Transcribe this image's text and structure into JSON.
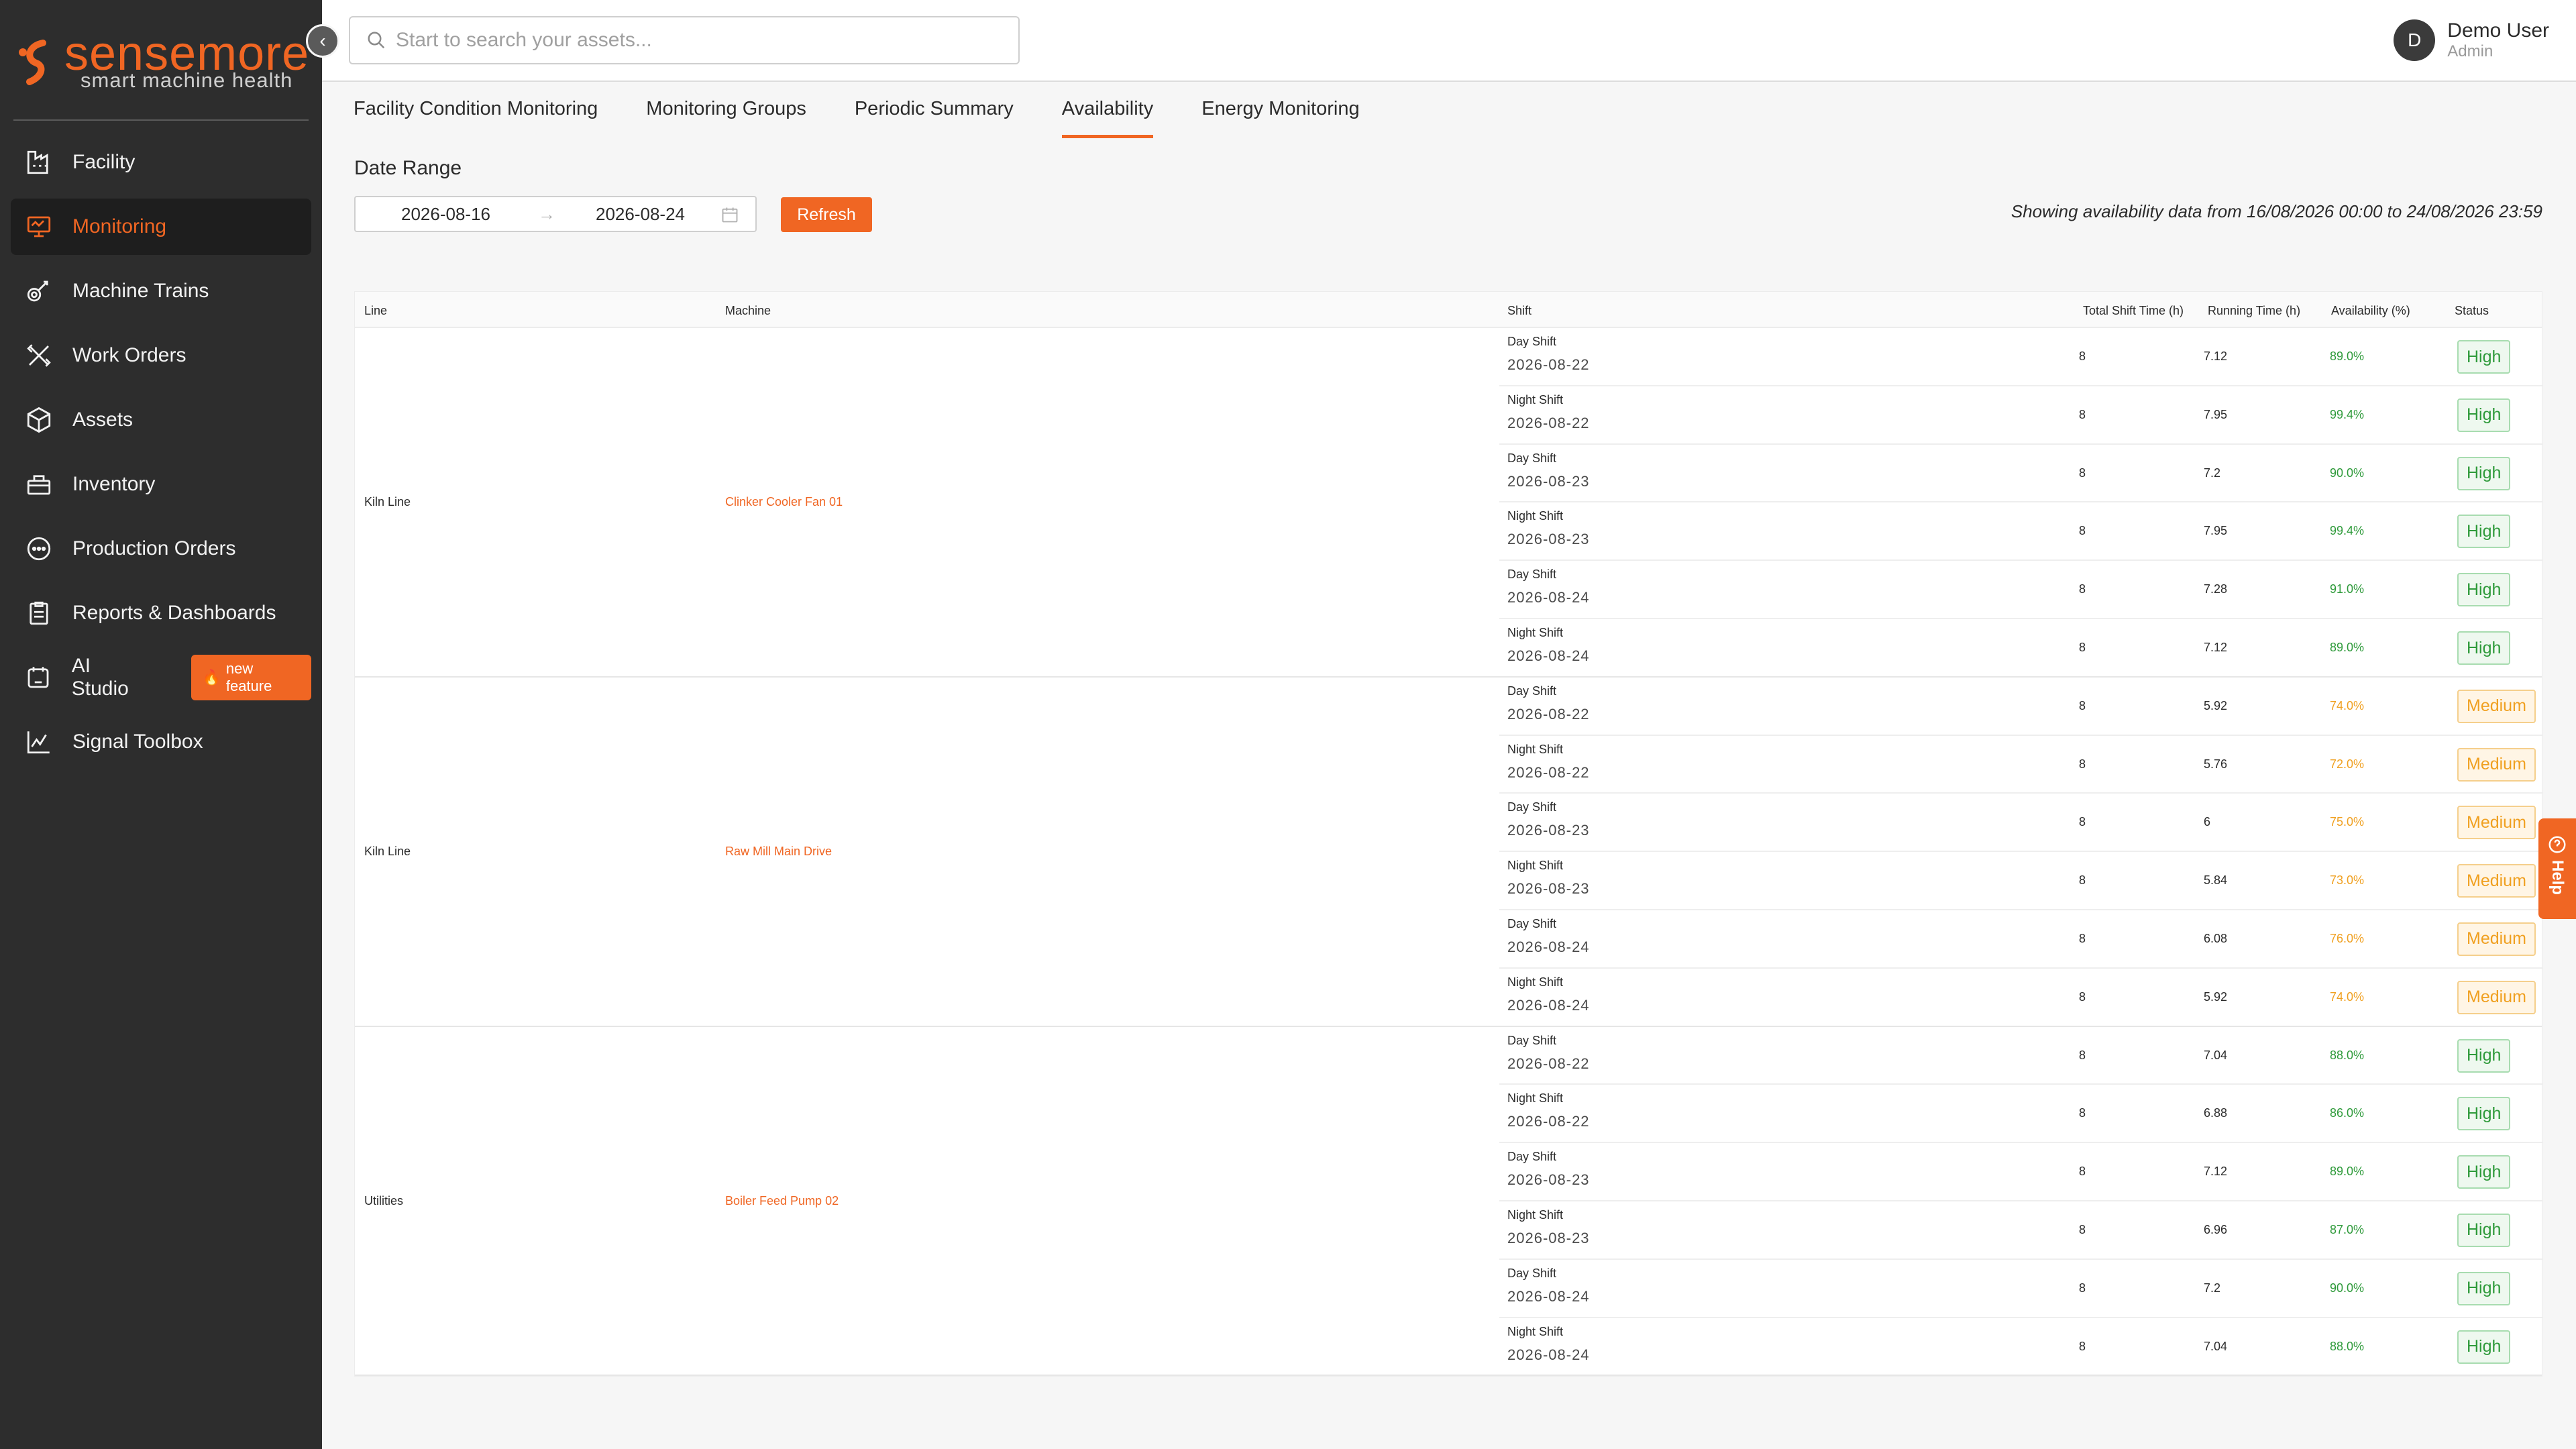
{
  "brand": {
    "name_part1": "sense",
    "name_part2": "more",
    "tagline": "smart machine health"
  },
  "search": {
    "placeholder": "Start to search your assets..."
  },
  "user": {
    "initial": "D",
    "name": "Demo User",
    "role": "Admin"
  },
  "sidebar": {
    "items": [
      {
        "label": "Facility",
        "icon": "facility-icon"
      },
      {
        "label": "Monitoring",
        "icon": "monitor-icon"
      },
      {
        "label": "Machine Trains",
        "icon": "machine-trains-icon"
      },
      {
        "label": "Work Orders",
        "icon": "tools-icon"
      },
      {
        "label": "Assets",
        "icon": "cube-icon"
      },
      {
        "label": "Inventory",
        "icon": "inventory-icon"
      },
      {
        "label": "Production Orders",
        "icon": "dots-circle-icon"
      },
      {
        "label": "Reports & Dashboards",
        "icon": "clipboard-icon"
      },
      {
        "label": "AI Studio",
        "icon": "ai-studio-icon",
        "badge": "new feature"
      },
      {
        "label": "Signal Toolbox",
        "icon": "chart-line-icon"
      }
    ]
  },
  "tabs": [
    "Facility Condition Monitoring",
    "Monitoring Groups",
    "Periodic Summary",
    "Availability",
    "Energy Monitoring"
  ],
  "filters": {
    "date_range_label": "Date Range",
    "start": "2026-08-16",
    "end": "2026-08-24",
    "refresh_label": "Refresh",
    "showing_text": "Showing availability data from 16/08/2026 00:00 to 24/08/2026 23:59"
  },
  "table": {
    "headers": [
      "Line",
      "Machine",
      "Shift",
      "Total Shift Time (h)",
      "Running Time (h)",
      "Availability (%)",
      "Status"
    ],
    "groups": [
      {
        "line": "Kiln Line",
        "machine": "Clinker Cooler Fan 01",
        "rows": [
          {
            "shift": "Day Shift",
            "date": "2026-08-22",
            "total": "8",
            "running": "7.12",
            "availability": "89.0%",
            "status": "High"
          },
          {
            "shift": "Night Shift",
            "date": "2026-08-22",
            "total": "8",
            "running": "7.95",
            "availability": "99.4%",
            "status": "High"
          },
          {
            "shift": "Day Shift",
            "date": "2026-08-23",
            "total": "8",
            "running": "7.2",
            "availability": "90.0%",
            "status": "High"
          },
          {
            "shift": "Night Shift",
            "date": "2026-08-23",
            "total": "8",
            "running": "7.95",
            "availability": "99.4%",
            "status": "High"
          },
          {
            "shift": "Day Shift",
            "date": "2026-08-24",
            "total": "8",
            "running": "7.28",
            "availability": "91.0%",
            "status": "High"
          },
          {
            "shift": "Night Shift",
            "date": "2026-08-24",
            "total": "8",
            "running": "7.12",
            "availability": "89.0%",
            "status": "High"
          }
        ]
      },
      {
        "line": "Kiln Line",
        "machine": "Raw Mill Main Drive",
        "rows": [
          {
            "shift": "Day Shift",
            "date": "2026-08-22",
            "total": "8",
            "running": "5.92",
            "availability": "74.0%",
            "status": "Medium"
          },
          {
            "shift": "Night Shift",
            "date": "2026-08-22",
            "total": "8",
            "running": "5.76",
            "availability": "72.0%",
            "status": "Medium"
          },
          {
            "shift": "Day Shift",
            "date": "2026-08-23",
            "total": "8",
            "running": "6",
            "availability": "75.0%",
            "status": "Medium"
          },
          {
            "shift": "Night Shift",
            "date": "2026-08-23",
            "total": "8",
            "running": "5.84",
            "availability": "73.0%",
            "status": "Medium"
          },
          {
            "shift": "Day Shift",
            "date": "2026-08-24",
            "total": "8",
            "running": "6.08",
            "availability": "76.0%",
            "status": "Medium"
          },
          {
            "shift": "Night Shift",
            "date": "2026-08-24",
            "total": "8",
            "running": "5.92",
            "availability": "74.0%",
            "status": "Medium"
          }
        ]
      },
      {
        "line": "Utilities",
        "machine": "Boiler Feed Pump 02",
        "rows": [
          {
            "shift": "Day Shift",
            "date": "2026-08-22",
            "total": "8",
            "running": "7.04",
            "availability": "88.0%",
            "status": "High"
          },
          {
            "shift": "Night Shift",
            "date": "2026-08-22",
            "total": "8",
            "running": "6.88",
            "availability": "86.0%",
            "status": "High"
          },
          {
            "shift": "Day Shift",
            "date": "2026-08-23",
            "total": "8",
            "running": "7.12",
            "availability": "89.0%",
            "status": "High"
          },
          {
            "shift": "Night Shift",
            "date": "2026-08-23",
            "total": "8",
            "running": "6.96",
            "availability": "87.0%",
            "status": "High"
          },
          {
            "shift": "Day Shift",
            "date": "2026-08-24",
            "total": "8",
            "running": "7.2",
            "availability": "90.0%",
            "status": "High"
          },
          {
            "shift": "Night Shift",
            "date": "2026-08-24",
            "total": "8",
            "running": "7.04",
            "availability": "88.0%",
            "status": "High"
          }
        ]
      }
    ]
  },
  "help": {
    "label": "Help"
  },
  "colors": {
    "accent": "#f06623",
    "sidebar_bg": "#2d2d2d",
    "high": "#2e9a3a",
    "medium": "#f0a020"
  }
}
